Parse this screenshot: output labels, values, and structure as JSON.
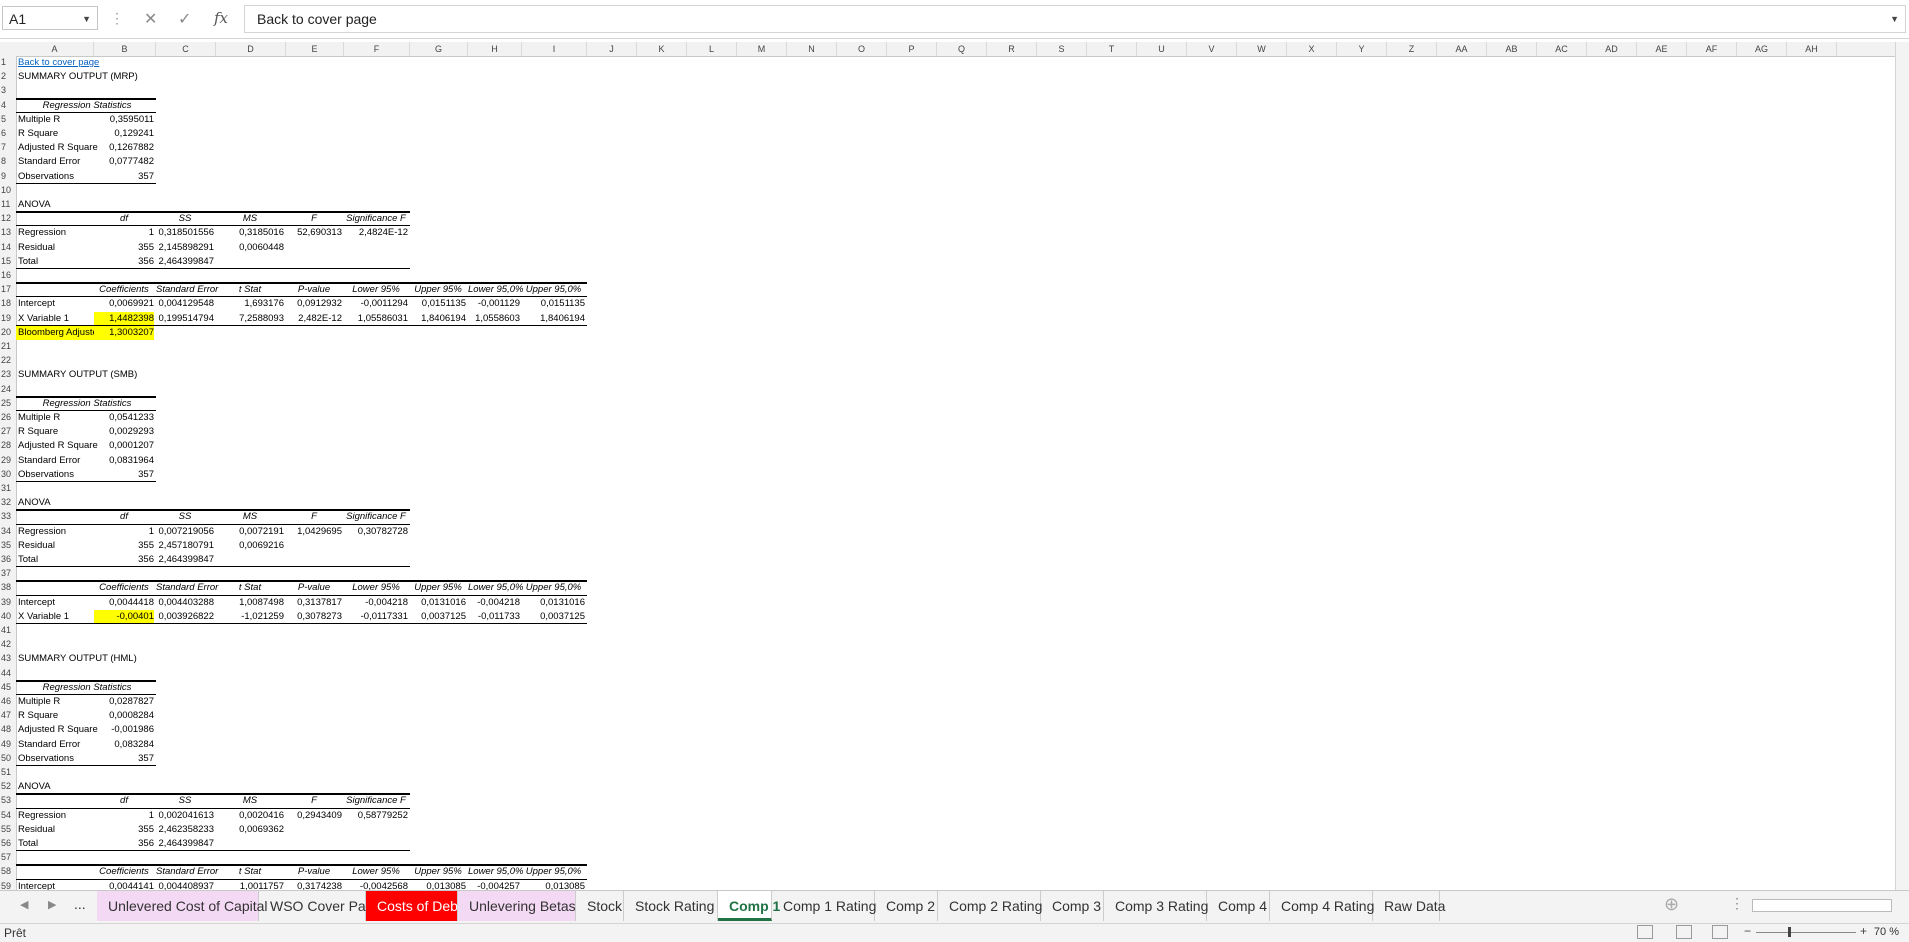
{
  "formula_bar": {
    "name_box": "A1",
    "formula": "Back to cover page"
  },
  "columns": [
    "A",
    "B",
    "C",
    "D",
    "E",
    "F",
    "G",
    "H",
    "I",
    "J",
    "K",
    "L",
    "M",
    "N",
    "O",
    "P",
    "Q",
    "R",
    "S",
    "T",
    "U",
    "V",
    "W",
    "X",
    "Y",
    "Z",
    "AA",
    "AB",
    "AC",
    "AD",
    "AE",
    "AF",
    "AG",
    "AH"
  ],
  "rows": [
    "1",
    "2",
    "3",
    "4",
    "5",
    "6",
    "7",
    "8",
    "9",
    "10",
    "11",
    "12",
    "13",
    "14",
    "15",
    "16",
    "17",
    "18",
    "19",
    "20",
    "21",
    "22",
    "23",
    "24",
    "25",
    "26",
    "27",
    "28",
    "29",
    "30",
    "31",
    "32",
    "33",
    "34",
    "35",
    "36",
    "37",
    "38",
    "39",
    "40",
    "41",
    "42",
    "43",
    "44",
    "45",
    "46",
    "47",
    "48",
    "49",
    "50",
    "51",
    "52",
    "53",
    "54",
    "55",
    "56",
    "57",
    "58",
    "59"
  ],
  "cells": {
    "r1": {
      "a": "Back to cover page"
    },
    "r2": {
      "a": "SUMMARY OUTPUT (MRP)"
    },
    "r4": {
      "a": "Regression Statistics"
    },
    "r5": {
      "a": "Multiple R",
      "b": "0,3595011"
    },
    "r6": {
      "a": "R Square",
      "b": "0,129241"
    },
    "r7": {
      "a": "Adjusted R Square",
      "b": "0,1267882"
    },
    "r8": {
      "a": "Standard Error",
      "b": "0,0777482"
    },
    "r9": {
      "a": "Observations",
      "b": "357"
    },
    "r11": {
      "a": "ANOVA"
    },
    "r12": {
      "b": "df",
      "c": "SS",
      "d": "MS",
      "e": "F",
      "f": "Significance F"
    },
    "r13": {
      "a": "Regression",
      "b": "1",
      "c": "0,318501556",
      "d": "0,3185016",
      "e": "52,690313",
      "f": "2,4824E-12"
    },
    "r14": {
      "a": "Residual",
      "b": "355",
      "c": "2,145898291",
      "d": "0,0060448"
    },
    "r15": {
      "a": "Total",
      "b": "356",
      "c": "2,464399847"
    },
    "r17": {
      "b": "Coefficients",
      "c": "Standard Error",
      "d": "t Stat",
      "e": "P-value",
      "f": "Lower 95%",
      "g": "Upper 95%",
      "h": "Lower 95,0%",
      "i": "Upper 95,0%"
    },
    "r18": {
      "a": "Intercept",
      "b": "0,0069921",
      "c": "0,004129548",
      "d": "1,693176",
      "e": "0,0912932",
      "f": "-0,0011294",
      "g": "0,0151135",
      "h": "-0,001129",
      "i": "0,0151135"
    },
    "r19": {
      "a": "X Variable 1",
      "b": "1,4482398",
      "c": "0,199514794",
      "d": "7,2588093",
      "e": "2,482E-12",
      "f": "1,05586031",
      "g": "1,8406194",
      "h": "1,0558603",
      "i": "1,8406194"
    },
    "r20": {
      "a": "Bloomberg Adjusted Beta",
      "b": "1,3003207"
    },
    "r23": {
      "a": "SUMMARY OUTPUT (SMB)"
    },
    "r25": {
      "a": "Regression Statistics"
    },
    "r26": {
      "a": "Multiple R",
      "b": "0,0541233"
    },
    "r27": {
      "a": "R Square",
      "b": "0,0029293"
    },
    "r28": {
      "a": "Adjusted R Square",
      "b": "0,0001207"
    },
    "r29": {
      "a": "Standard Error",
      "b": "0,0831964"
    },
    "r30": {
      "a": "Observations",
      "b": "357"
    },
    "r32": {
      "a": "ANOVA"
    },
    "r33": {
      "b": "df",
      "c": "SS",
      "d": "MS",
      "e": "F",
      "f": "Significance F"
    },
    "r34": {
      "a": "Regression",
      "b": "1",
      "c": "0,007219056",
      "d": "0,0072191",
      "e": "1,0429695",
      "f": "0,30782728"
    },
    "r35": {
      "a": "Residual",
      "b": "355",
      "c": "2,457180791",
      "d": "0,0069216"
    },
    "r36": {
      "a": "Total",
      "b": "356",
      "c": "2,464399847"
    },
    "r38": {
      "b": "Coefficients",
      "c": "Standard Error",
      "d": "t Stat",
      "e": "P-value",
      "f": "Lower 95%",
      "g": "Upper 95%",
      "h": "Lower 95,0%",
      "i": "Upper 95,0%"
    },
    "r39": {
      "a": "Intercept",
      "b": "0,0044418",
      "c": "0,004403288",
      "d": "1,0087498",
      "e": "0,3137817",
      "f": "-0,004218",
      "g": "0,0131016",
      "h": "-0,004218",
      "i": "0,0131016"
    },
    "r40": {
      "a": "X Variable 1",
      "b": "-0,00401",
      "c": "0,003926822",
      "d": "-1,021259",
      "e": "0,3078273",
      "f": "-0,0117331",
      "g": "0,0037125",
      "h": "-0,011733",
      "i": "0,0037125"
    },
    "r43": {
      "a": "SUMMARY OUTPUT (HML)"
    },
    "r45": {
      "a": "Regression Statistics"
    },
    "r46": {
      "a": "Multiple R",
      "b": "0,0287827"
    },
    "r47": {
      "a": "R Square",
      "b": "0,0008284"
    },
    "r48": {
      "a": "Adjusted R Square",
      "b": "-0,001986"
    },
    "r49": {
      "a": "Standard Error",
      "b": "0,083284"
    },
    "r50": {
      "a": "Observations",
      "b": "357"
    },
    "r52": {
      "a": "ANOVA"
    },
    "r53": {
      "b": "df",
      "c": "SS",
      "d": "MS",
      "e": "F",
      "f": "Significance F"
    },
    "r54": {
      "a": "Regression",
      "b": "1",
      "c": "0,002041613",
      "d": "0,0020416",
      "e": "0,2943409",
      "f": "0,58779252"
    },
    "r55": {
      "a": "Residual",
      "b": "355",
      "c": "2,462358233",
      "d": "0,0069362"
    },
    "r56": {
      "a": "Total",
      "b": "356",
      "c": "2,464399847"
    },
    "r58": {
      "b": "Coefficients",
      "c": "Standard Error",
      "d": "t Stat",
      "e": "P-value",
      "f": "Lower 95%",
      "g": "Upper 95%",
      "h": "Lower 95,0%",
      "i": "Upper 95,0%"
    },
    "r59": {
      "a": "Intercept",
      "b": "0,0044141",
      "c": "0,004408937",
      "d": "1,0011757",
      "e": "0,3174238",
      "f": "-0,0042568",
      "g": "0,013085",
      "h": "-0,004257",
      "i": "0,013085"
    }
  },
  "tabs": [
    {
      "label": "Unlevered Cost of Capital",
      "color": "#f4d9f4"
    },
    {
      "label": "WSO Cover Page",
      "color": ""
    },
    {
      "label": "Costs of Debt",
      "color": "#ff0000"
    },
    {
      "label": "Unlevering Betas",
      "color": "#f4d9f4"
    },
    {
      "label": "Stock",
      "color": ""
    },
    {
      "label": "Stock Rating",
      "color": ""
    },
    {
      "label": "Comp 1",
      "color": "",
      "active": true
    },
    {
      "label": "Comp 1 Rating",
      "color": ""
    },
    {
      "label": "Comp 2",
      "color": ""
    },
    {
      "label": "Comp 2 Rating",
      "color": ""
    },
    {
      "label": "Comp 3",
      "color": ""
    },
    {
      "label": "Comp 3 Rating",
      "color": ""
    },
    {
      "label": "Comp 4",
      "color": ""
    },
    {
      "label": "Comp 4 Rating",
      "color": ""
    },
    {
      "label": "Raw Data",
      "color": ""
    }
  ],
  "tab_overflow": "...",
  "status": {
    "text": "Prêt",
    "zoom": "70 %"
  },
  "highlight_color": "#ffff00"
}
